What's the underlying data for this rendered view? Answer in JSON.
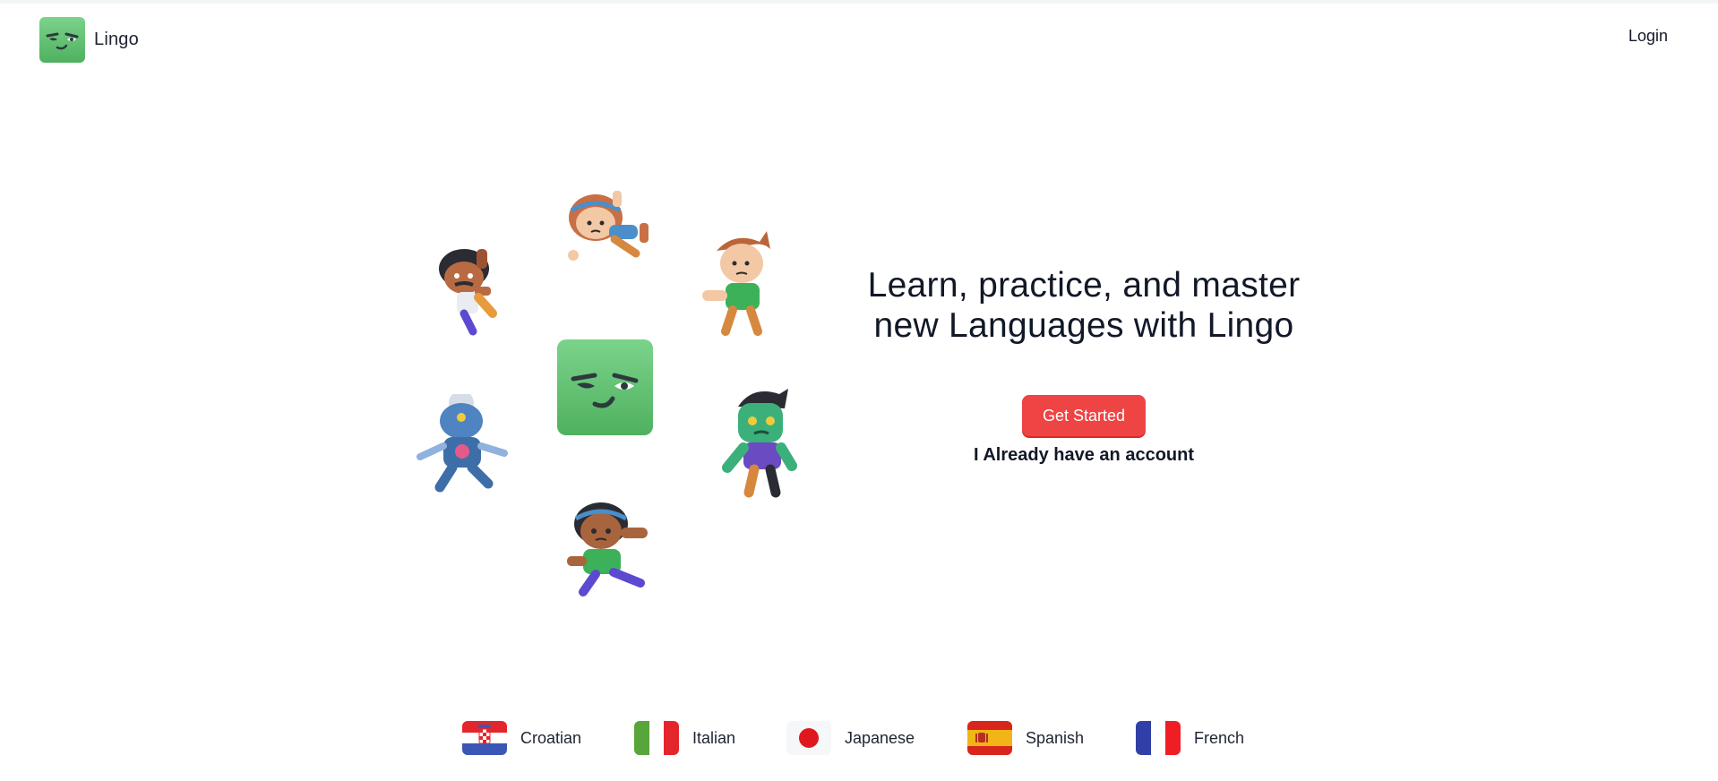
{
  "header": {
    "brand_name": "Lingo",
    "login_label": "Login"
  },
  "hero": {
    "headline_line1": "Learn, practice, and master",
    "headline_line2": "new Languages with Lingo",
    "primary_cta": "Get Started",
    "secondary_cta": "I Already have an account"
  },
  "languages": [
    {
      "name": "Croatian",
      "flag": "croatia-flag-icon"
    },
    {
      "name": "Italian",
      "flag": "italy-flag-icon"
    },
    {
      "name": "Japanese",
      "flag": "japan-flag-icon"
    },
    {
      "name": "Spanish",
      "flag": "spain-flag-icon"
    },
    {
      "name": "French",
      "flag": "france-flag-icon"
    }
  ],
  "colors": {
    "brand_green": "#5cbf6b",
    "cta_red": "#ef4444",
    "text_dark": "#111827"
  }
}
